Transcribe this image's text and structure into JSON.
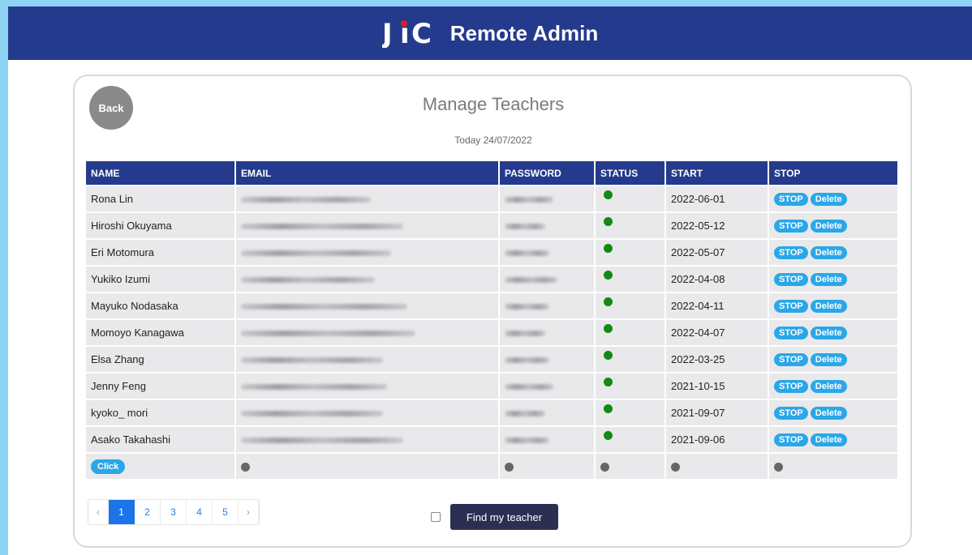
{
  "header": {
    "logo_text": "JiC",
    "title": "Remote Admin"
  },
  "page": {
    "back_label": "Back",
    "title": "Manage Teachers",
    "today": "Today 24/07/2022"
  },
  "table": {
    "columns": [
      "NAME",
      "EMAIL",
      "PASSWORD",
      "STATUS",
      "START",
      "STOP"
    ],
    "rows": [
      {
        "name": "Rona Lin",
        "start": "2022-06-01",
        "status": "active"
      },
      {
        "name": "Hiroshi Okuyama",
        "start": "2022-05-12",
        "status": "active"
      },
      {
        "name": "Eri Motomura",
        "start": "2022-05-07",
        "status": "active"
      },
      {
        "name": "Yukiko Izumi",
        "start": "2022-04-08",
        "status": "active"
      },
      {
        "name": "Mayuko Nodasaka",
        "start": "2022-04-11",
        "status": "active"
      },
      {
        "name": "Momoyo Kanagawa",
        "start": "2022-04-07",
        "status": "active"
      },
      {
        "name": "Elsa Zhang",
        "start": "2022-03-25",
        "status": "active"
      },
      {
        "name": "Jenny Feng",
        "start": "2021-10-15",
        "status": "active"
      },
      {
        "name": "kyoko_ mori",
        "start": "2021-09-07",
        "status": "active"
      },
      {
        "name": "Asako Takahashi",
        "start": "2021-09-06",
        "status": "active"
      }
    ],
    "stop_label": "STOP",
    "delete_label": "Delete",
    "add_row_label": "Click"
  },
  "pagination": {
    "prev": "‹",
    "next": "›",
    "pages": [
      "1",
      "2",
      "3",
      "4",
      "5"
    ],
    "active_page": "1"
  },
  "footer": {
    "find_label": "Find my teacher"
  },
  "colors": {
    "brand": "#243a8c",
    "status_active": "#138a13",
    "pill": "#2aa7e8"
  }
}
